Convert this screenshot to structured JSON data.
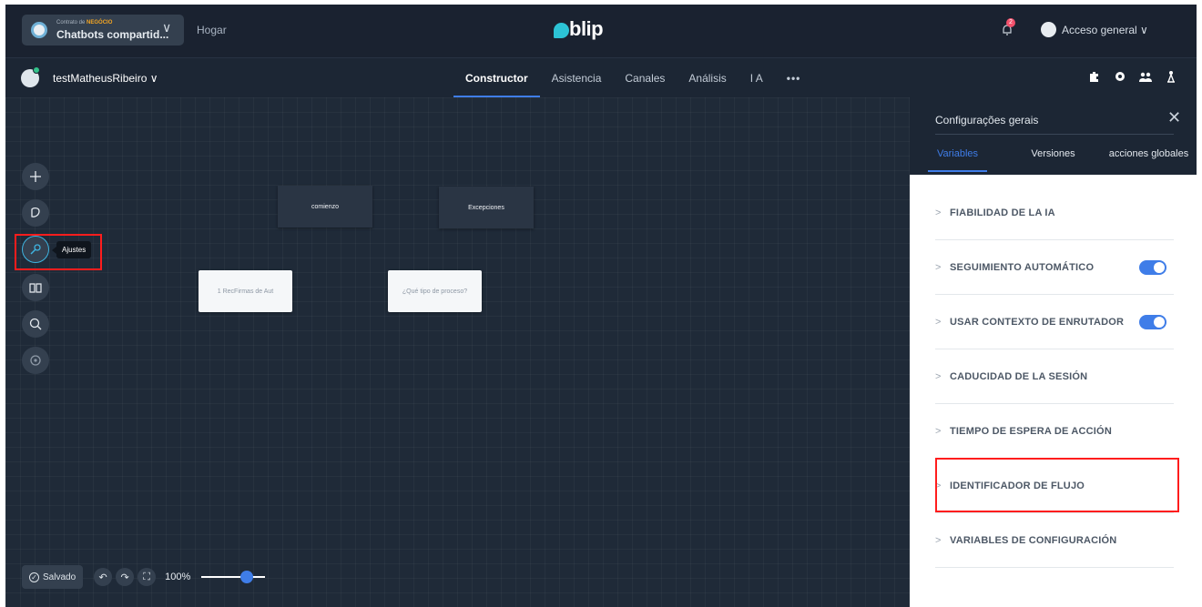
{
  "topbar": {
    "contract_prefix": "Contrato de",
    "contract_tier": "NEGÓCIO",
    "contract_name": "Chatbots compartid...",
    "home": "Hogar",
    "logo": "blip",
    "notifications_count": "2",
    "account": "Acceso general ∨"
  },
  "navbar": {
    "bot_name": "testMatheusRibeiro ∨",
    "tabs": [
      {
        "label": "Constructor",
        "active": true
      },
      {
        "label": "Asistencia"
      },
      {
        "label": "Canales"
      },
      {
        "label": "Análisis"
      },
      {
        "label": "I A"
      },
      {
        "label": "•••"
      }
    ]
  },
  "canvas": {
    "tooltip": "Ajustes",
    "nodes": [
      "comienzo",
      "Excepciones",
      "1 RecFirmas de Aut",
      "¿Qué tipo de proceso?"
    ],
    "saved": "Salvado",
    "zoom": "100%",
    "zoom_level_percent": 100
  },
  "panel": {
    "title": "Configurações gerais",
    "tabs": [
      "Variables",
      "Versiones",
      "acciones globales"
    ],
    "items": [
      {
        "label": "FIABILIDAD DE LA IA",
        "toggle": false
      },
      {
        "label": "SEGUIMIENTO AUTOMÁTICO",
        "toggle": true
      },
      {
        "label": "USAR CONTEXTO DE ENRUTADOR",
        "toggle": true
      },
      {
        "label": "CADUCIDAD DE LA SESIÓN",
        "toggle": false
      },
      {
        "label": "TIEMPO DE ESPERA DE ACCIÓN",
        "toggle": false
      },
      {
        "label": "IDENTIFICADOR DE FLUJO",
        "toggle": false
      },
      {
        "label": "VARIABLES DE CONFIGURACIÓN",
        "toggle": false
      }
    ]
  },
  "colors": {
    "accent": "#3f7de8",
    "highlight": "#ff1d1d",
    "brand": "#2cc3d5"
  }
}
